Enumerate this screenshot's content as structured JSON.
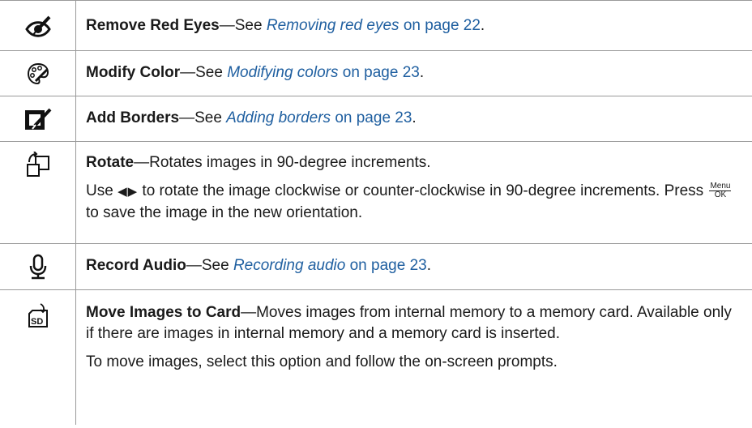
{
  "rows": [
    {
      "icon": "red-eye-pen-icon",
      "title": "Remove Red Eyes",
      "dash": "—See ",
      "link": "Removing red eyes",
      "suffix": " on page 22",
      "end": "."
    },
    {
      "icon": "palette-icon",
      "title": "Modify Color",
      "dash": "—See ",
      "link": "Modifying colors",
      "suffix": " on page 23",
      "end": "."
    },
    {
      "icon": "border-brush-icon",
      "title": "Add Borders",
      "dash": "—See ",
      "link": "Adding borders",
      "suffix": " on page 23",
      "end": "."
    },
    {
      "icon": "rotate-icon",
      "title": "Rotate",
      "desc": "—Rotates images in 90-degree increments.",
      "p2_a": "Use ",
      "p2_arrows": "◀▶",
      "p2_b": " to rotate the image clockwise or counter-clockwise in 90-degree increments. Press ",
      "menu_top": "Menu",
      "menu_bottom": "OK",
      "p2_c": " to save the image in the new orientation."
    },
    {
      "icon": "microphone-icon",
      "title": "Record Audio",
      "dash": "—See ",
      "link": "Recording audio",
      "suffix": " on page 23",
      "end": "."
    },
    {
      "icon": "move-to-sd-icon",
      "title": "Move Images to Card",
      "desc": "—Moves images from internal memory to a memory card. Available only if there are images in internal memory and a memory card is inserted.",
      "p2": "To move images, select this option and follow the on-screen prompts."
    }
  ],
  "colors": {
    "link": "#1f5fa0",
    "rule": "#9a9a9a"
  }
}
